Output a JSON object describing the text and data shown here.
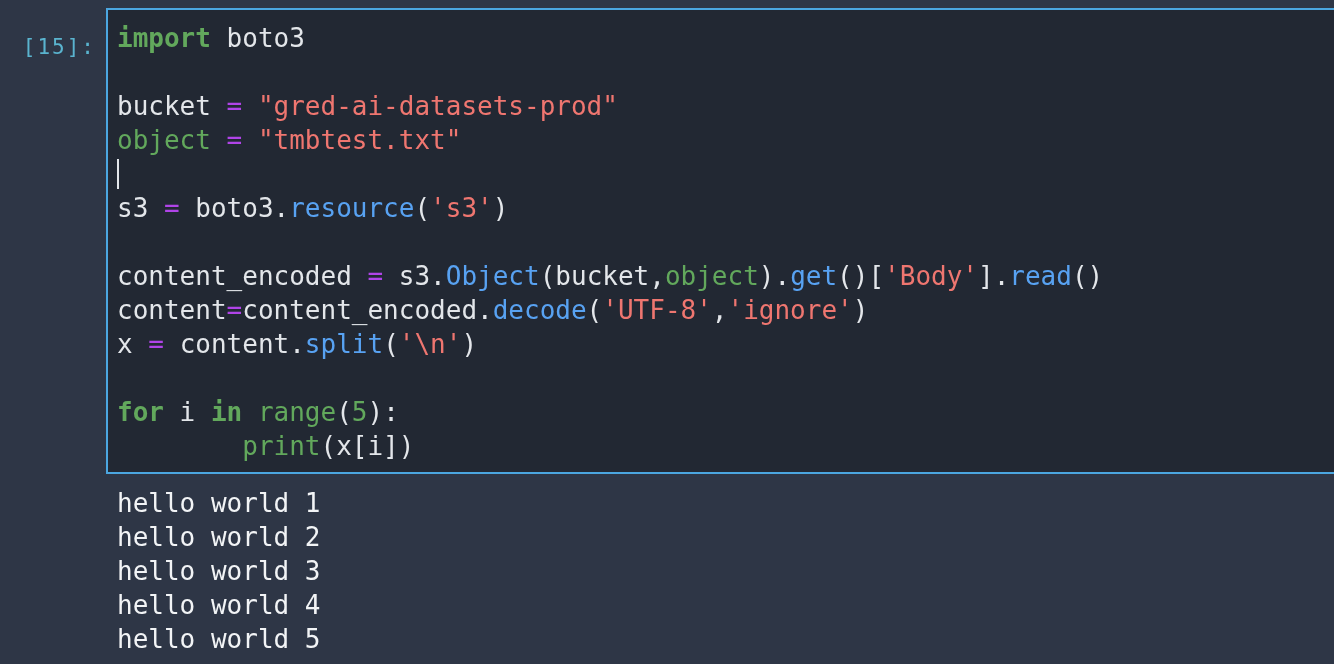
{
  "cell": {
    "prompt": "[15]:",
    "selected": true,
    "lines": [
      {
        "cursor": false,
        "tokens": [
          {
            "kind": "keyword",
            "text": "import"
          },
          {
            "kind": "plain",
            "text": " boto3"
          }
        ]
      },
      {
        "cursor": false
      },
      {
        "cursor": false,
        "tokens": [
          {
            "kind": "plain",
            "text": "bucket"
          },
          {
            "kind": "operator",
            "text": " = "
          },
          {
            "kind": "string",
            "text": "\"gred-ai-datasets-prod\""
          }
        ]
      },
      {
        "cursor": false,
        "tokens": [
          {
            "kind": "builtin",
            "text": "object"
          },
          {
            "kind": "operator",
            "text": " = "
          },
          {
            "kind": "string",
            "text": "\"tmbtest.txt\""
          }
        ]
      },
      {
        "cursor": true
      },
      {
        "cursor": false,
        "tokens": [
          {
            "kind": "plain",
            "text": "s3"
          },
          {
            "kind": "operator",
            "text": " = "
          },
          {
            "kind": "plain",
            "text": "boto3."
          },
          {
            "kind": "method",
            "text": "resource"
          },
          {
            "kind": "plain",
            "text": "("
          },
          {
            "kind": "string",
            "text": "'s3'"
          },
          {
            "kind": "plain",
            "text": ")"
          }
        ]
      },
      {
        "cursor": false
      },
      {
        "cursor": false,
        "tokens": [
          {
            "kind": "plain",
            "text": "content_encoded"
          },
          {
            "kind": "operator",
            "text": " = "
          },
          {
            "kind": "plain",
            "text": "s3."
          },
          {
            "kind": "method",
            "text": "Object"
          },
          {
            "kind": "plain",
            "text": "(bucket,"
          },
          {
            "kind": "builtin",
            "text": "object"
          },
          {
            "kind": "plain",
            "text": ")."
          },
          {
            "kind": "method",
            "text": "get"
          },
          {
            "kind": "plain",
            "text": "()["
          },
          {
            "kind": "string",
            "text": "'Body'"
          },
          {
            "kind": "plain",
            "text": "]."
          },
          {
            "kind": "method",
            "text": "read"
          },
          {
            "kind": "plain",
            "text": "()"
          }
        ]
      },
      {
        "cursor": false,
        "tokens": [
          {
            "kind": "plain",
            "text": "content"
          },
          {
            "kind": "operator",
            "text": "="
          },
          {
            "kind": "plain",
            "text": "content_encoded."
          },
          {
            "kind": "method",
            "text": "decode"
          },
          {
            "kind": "plain",
            "text": "("
          },
          {
            "kind": "string",
            "text": "'UTF-8'"
          },
          {
            "kind": "plain",
            "text": ","
          },
          {
            "kind": "string",
            "text": "'ignore'"
          },
          {
            "kind": "plain",
            "text": ")"
          }
        ]
      },
      {
        "cursor": false,
        "tokens": [
          {
            "kind": "plain",
            "text": "x"
          },
          {
            "kind": "operator",
            "text": " = "
          },
          {
            "kind": "plain",
            "text": "content."
          },
          {
            "kind": "method",
            "text": "split"
          },
          {
            "kind": "plain",
            "text": "("
          },
          {
            "kind": "string",
            "text": "'\\n'"
          },
          {
            "kind": "plain",
            "text": ")"
          }
        ]
      },
      {
        "cursor": false
      },
      {
        "cursor": false,
        "tokens": [
          {
            "kind": "keyword",
            "text": "for"
          },
          {
            "kind": "plain",
            "text": " i "
          },
          {
            "kind": "keyword",
            "text": "in"
          },
          {
            "kind": "builtin",
            "text": " range"
          },
          {
            "kind": "plain",
            "text": "("
          },
          {
            "kind": "number",
            "text": "5"
          },
          {
            "kind": "plain",
            "text": "):"
          }
        ]
      },
      {
        "cursor": false,
        "tokens": [
          {
            "kind": "builtin",
            "text": "        print"
          },
          {
            "kind": "plain",
            "text": "(x[i])"
          }
        ]
      }
    ]
  },
  "output": [
    "hello world 1",
    "hello world 2",
    "hello world 3",
    "hello world 4",
    "hello world 5"
  ]
}
